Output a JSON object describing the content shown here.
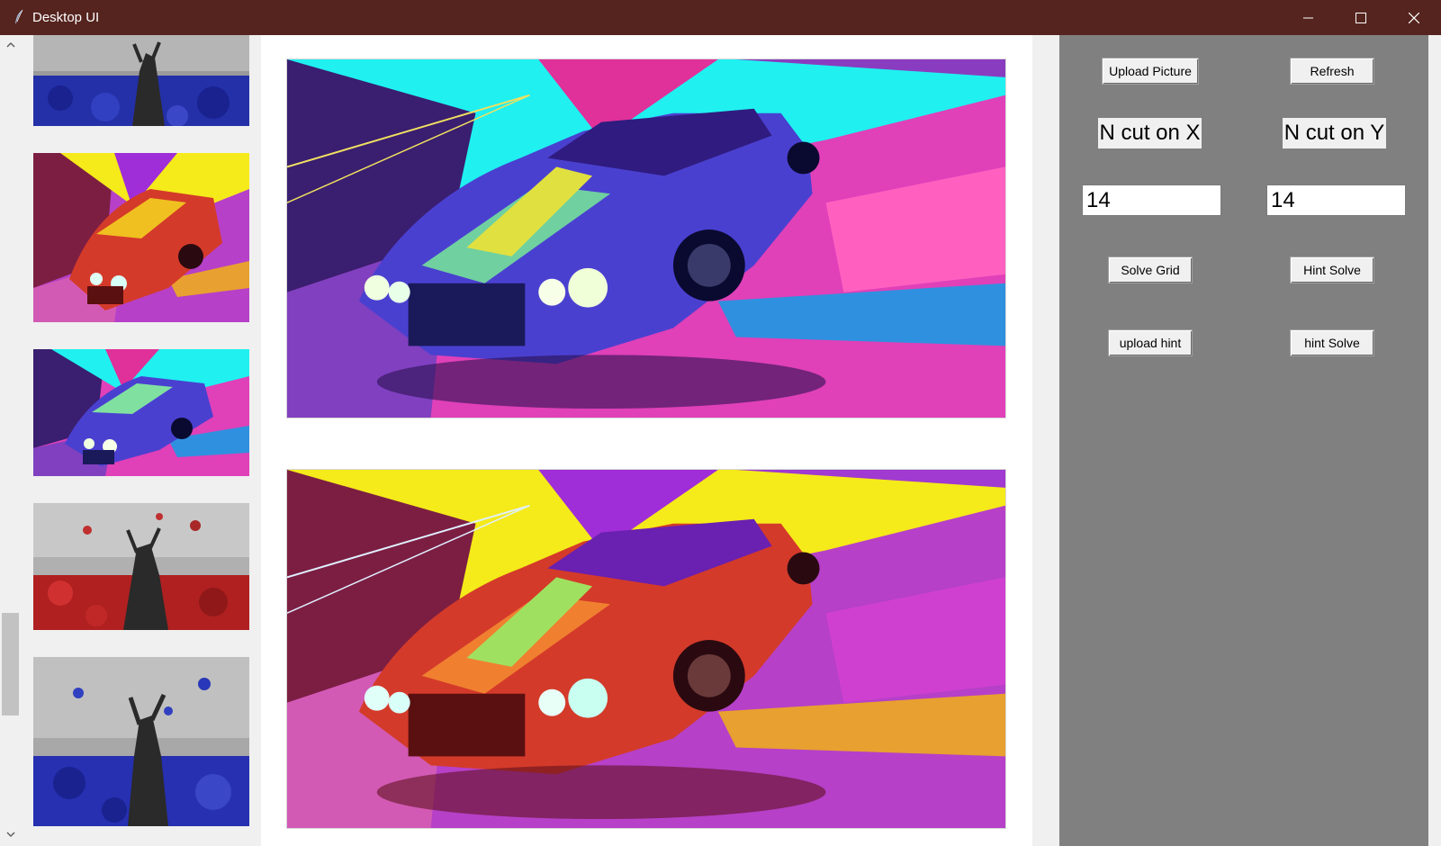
{
  "window": {
    "title": "Desktop UI",
    "titlebar_color": "#55241e"
  },
  "thumbnails": [
    {
      "name": "statue-blue-flowers-partial",
      "palette": "blue-gray"
    },
    {
      "name": "car-warm-yellow",
      "palette": "yellow-red-magenta"
    },
    {
      "name": "car-cyan-blue",
      "palette": "cyan-blue-magenta"
    },
    {
      "name": "statue-red-leaves",
      "palette": "red-gray"
    },
    {
      "name": "statue-blue-leaves",
      "palette": "blue-gray"
    }
  ],
  "canvas": {
    "top_image": "car-cyan-blue",
    "bottom_image": "car-warm-yellow"
  },
  "controls": {
    "upload_picture_label": "Upload Picture",
    "refresh_label": "Refresh",
    "n_cut_x_label": "N cut on X",
    "n_cut_y_label": "N cut on Y",
    "n_cut_x_value": "14",
    "n_cut_y_value": "14",
    "solve_grid_label": "Solve Grid",
    "hint_solve_label": "Hint Solve",
    "upload_hint_label": "upload hint",
    "hint_solve_lower_label": "hint Solve",
    "panel_color": "#808080"
  }
}
